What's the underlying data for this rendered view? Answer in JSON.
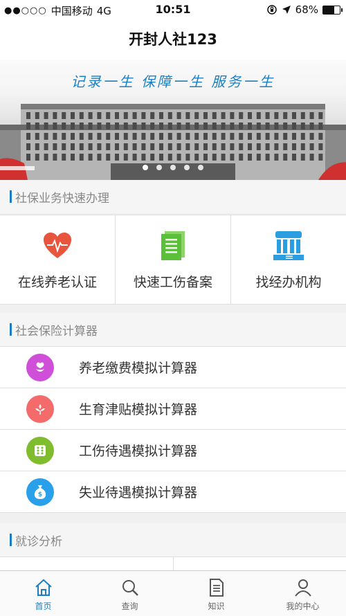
{
  "status_bar": {
    "signal_dots": "●●○○○",
    "carrier": "中国移动",
    "network": "4G",
    "time": "10:51",
    "battery_text": "68%",
    "battery_level": 0.68
  },
  "nav": {
    "title": "开封人社123"
  },
  "banner": {
    "slogan": "记录一生 保障一生 服务一生",
    "page_count": 5,
    "active_page": 0
  },
  "quick_section": {
    "title": "社保业务快速办理",
    "items": [
      {
        "label": "在线养老认证",
        "icon": "heart-pulse-icon",
        "color": "#e8553e"
      },
      {
        "label": "快速工伤备案",
        "icon": "document-icon",
        "color": "#5cbf3a"
      },
      {
        "label": "找经办机构",
        "icon": "institution-building-icon",
        "color": "#2a9ee0"
      }
    ]
  },
  "calc_section": {
    "title": "社会保险计算器",
    "items": [
      {
        "label": "养老缴费模拟计算器",
        "icon": "flower-icon",
        "color": "#d04fd8"
      },
      {
        "label": "生育津贴模拟计算器",
        "icon": "sprout-icon",
        "color": "#f46b6b"
      },
      {
        "label": "工伤待遇模拟计算器",
        "icon": "dice-icon",
        "color": "#7fbd2f"
      },
      {
        "label": "失业待遇模拟计算器",
        "icon": "money-bag-icon",
        "color": "#2aa0ea"
      }
    ]
  },
  "diag_section": {
    "title": "就诊分析"
  },
  "tab_bar": {
    "tabs": [
      {
        "label": "首页",
        "icon": "home-icon",
        "active": true
      },
      {
        "label": "查询",
        "icon": "search-icon",
        "active": false
      },
      {
        "label": "知识",
        "icon": "document-icon",
        "active": false
      },
      {
        "label": "我的中心",
        "icon": "user-icon",
        "active": false
      }
    ]
  },
  "colors": {
    "accent": "#1a7fc2",
    "background": "#f0f0f0"
  }
}
